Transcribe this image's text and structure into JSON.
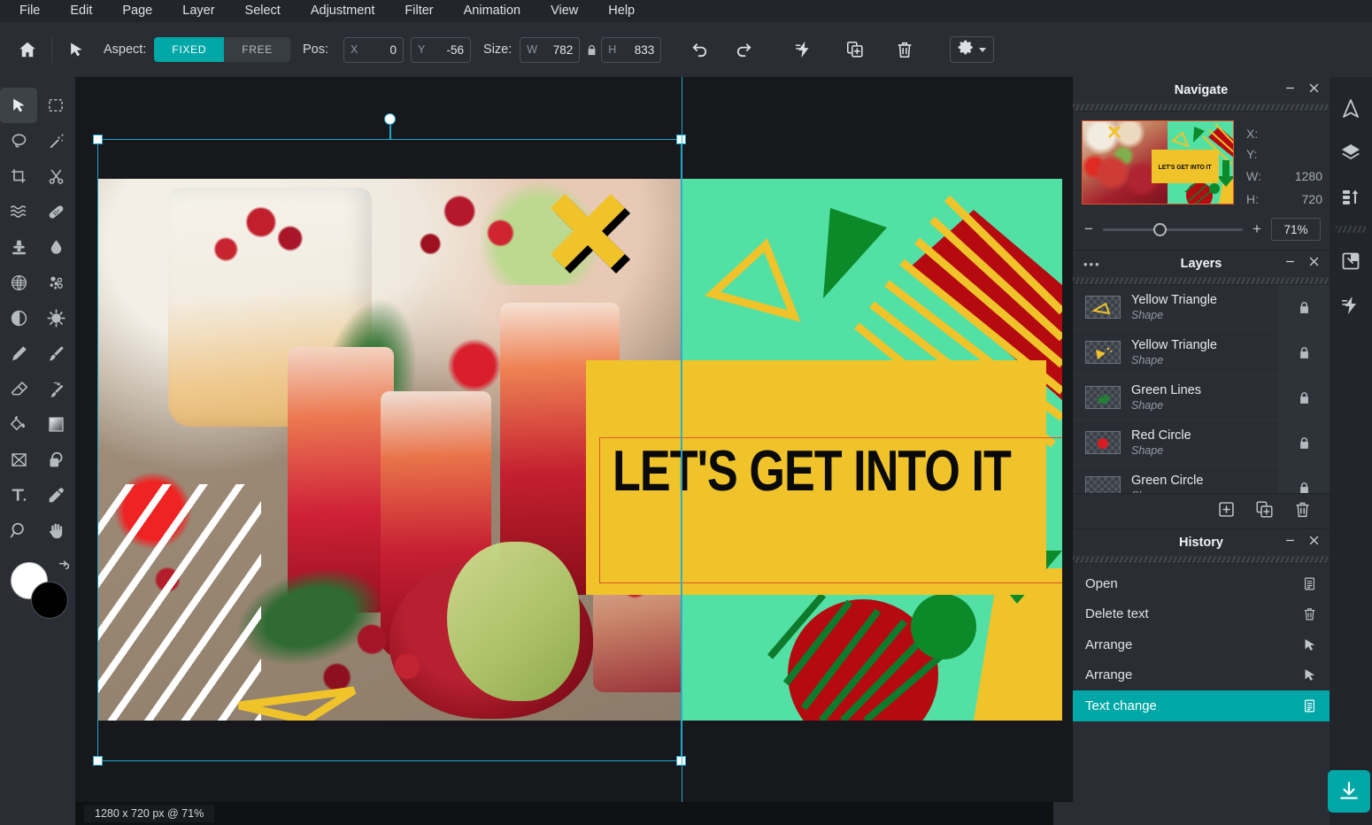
{
  "menu": {
    "items": [
      "File",
      "Edit",
      "Page",
      "Layer",
      "Select",
      "Adjustment",
      "Filter",
      "Animation",
      "View",
      "Help"
    ]
  },
  "toolbar": {
    "home_icon": "home-icon",
    "tool_icon": "cursor-icon",
    "aspect_label": "Aspect:",
    "aspect_fixed": "FIXED",
    "aspect_free": "FREE",
    "pos_label": "Pos:",
    "pos_x_label": "X",
    "pos_x_value": "0",
    "pos_y_label": "Y",
    "pos_y_value": "-56",
    "size_label": "Size:",
    "size_w_label": "W",
    "size_w_value": "782",
    "size_h_label": "H",
    "size_h_value": "833",
    "lock_icon": "lock-icon",
    "undo_icon": "undo-icon",
    "redo_icon": "redo-icon",
    "effects_icon": "lightning-icon",
    "duplicate_icon": "duplicate-icon",
    "delete_icon": "trash-icon",
    "settings_icon": "gear-icon"
  },
  "tools": [
    {
      "name": "move-tool",
      "icon": "cursor-icon",
      "selected": true
    },
    {
      "name": "marquee-select-tool",
      "icon": "marquee-icon",
      "selected": false
    },
    {
      "name": "lasso-tool",
      "icon": "lasso-icon",
      "selected": false
    },
    {
      "name": "magic-wand-tool",
      "icon": "magic-wand-icon",
      "selected": false
    },
    {
      "name": "crop-tool",
      "icon": "crop-icon",
      "selected": false
    },
    {
      "name": "cut-tool",
      "icon": "scissors-icon",
      "selected": false
    },
    {
      "name": "smudge-tool",
      "icon": "wave-icon",
      "selected": false
    },
    {
      "name": "heal-tool",
      "icon": "bandage-icon",
      "selected": false
    },
    {
      "name": "clone-stamp-tool",
      "icon": "stamp-icon",
      "selected": false
    },
    {
      "name": "blur-tool",
      "icon": "droplet-icon",
      "selected": false
    },
    {
      "name": "halftone-tool",
      "icon": "globe-grid-icon",
      "selected": false
    },
    {
      "name": "bokeh-tool",
      "icon": "dots-icon",
      "selected": false
    },
    {
      "name": "contrast-tool",
      "icon": "contrast-icon",
      "selected": false
    },
    {
      "name": "sharpen-tool",
      "icon": "sun-gear-icon",
      "selected": false
    },
    {
      "name": "pen-tool",
      "icon": "pen-icon",
      "selected": false
    },
    {
      "name": "brush-tool",
      "icon": "brush-icon",
      "selected": false
    },
    {
      "name": "eraser-tool",
      "icon": "eraser-icon",
      "selected": false
    },
    {
      "name": "history-brush-tool",
      "icon": "history-brush-icon",
      "selected": false
    },
    {
      "name": "paint-bucket-tool",
      "icon": "paint-bucket-icon",
      "selected": false
    },
    {
      "name": "gradient-tool",
      "icon": "gradient-icon",
      "selected": false
    },
    {
      "name": "transform-tool",
      "icon": "transform-box-icon",
      "selected": false
    },
    {
      "name": "shape-tool",
      "icon": "rounded-shape-icon",
      "selected": false
    },
    {
      "name": "text-tool",
      "icon": "text-t-icon",
      "selected": false
    },
    {
      "name": "eyedropper-tool",
      "icon": "eyedropper-icon",
      "selected": false
    },
    {
      "name": "zoom-tool",
      "icon": "magnifier-icon",
      "selected": false
    },
    {
      "name": "hand-tool",
      "icon": "hand-icon",
      "selected": false
    }
  ],
  "color_swatches": {
    "foreground": "#ffffff",
    "background": "#000000",
    "swap_icon": "swap-arrows-icon"
  },
  "canvas": {
    "banner_text": "LET'S GET INTO IT",
    "status": "1280 x 720 px @ 71%",
    "colors": {
      "mint": "#52e0a4",
      "yellow": "#f0c32b",
      "dark_green": "#0c8a2a",
      "dark_red": "#b50a10",
      "selection": "#1ba7d0",
      "text_box_outline": "#e0552a"
    }
  },
  "navigate": {
    "title": "Navigate",
    "minimize_icon": "minimize-icon",
    "close_icon": "close-icon",
    "x_label": "X:",
    "x_value": "",
    "y_label": "Y:",
    "y_value": "",
    "w_label": "W:",
    "w_value": "1280",
    "h_label": "H:",
    "h_value": "720",
    "zoom_minus": "−",
    "zoom_plus": "+",
    "zoom_value": "71%",
    "thumb_text": "LET'S GET INTO IT"
  },
  "layers": {
    "title": "Layers",
    "options_icon": "more-options-icon",
    "minimize_icon": "minimize-icon",
    "close_icon": "close-icon",
    "items": [
      {
        "name": "Yellow Triangle",
        "type": "Shape",
        "lock_icon": "lock-icon",
        "thumb": "yellow-triangle-outline"
      },
      {
        "name": "Yellow Triangle",
        "type": "Shape",
        "lock_icon": "lock-icon",
        "thumb": "yellow-triangle-filled"
      },
      {
        "name": "Green Lines",
        "type": "Shape",
        "lock_icon": "lock-icon",
        "thumb": "green-lines"
      },
      {
        "name": "Red Circle",
        "type": "Shape",
        "lock_icon": "lock-icon",
        "thumb": "red-circle"
      },
      {
        "name": "Green Circle",
        "type": "Shape",
        "lock_icon": "lock-icon",
        "thumb": "green-circle"
      }
    ],
    "footer": {
      "add_icon": "add-layer-icon",
      "duplicate_icon": "duplicate-layer-icon",
      "delete_icon": "trash-icon"
    }
  },
  "history": {
    "title": "History",
    "minimize_icon": "minimize-icon",
    "close_icon": "close-icon",
    "items": [
      {
        "label": "Open",
        "icon": "document-icon",
        "active": false
      },
      {
        "label": "Delete text",
        "icon": "trash-icon",
        "active": false
      },
      {
        "label": "Arrange",
        "icon": "cursor-icon",
        "active": false
      },
      {
        "label": "Arrange",
        "icon": "cursor-icon",
        "active": false
      },
      {
        "label": "Text change",
        "icon": "document-icon",
        "active": true
      }
    ]
  },
  "edge_rail": {
    "items": [
      {
        "name": "navigate-panel-toggle",
        "icon": "compass-icon"
      },
      {
        "name": "layers-panel-toggle",
        "icon": "layers-icon"
      },
      {
        "name": "history-panel-toggle",
        "icon": "history-icon"
      },
      {
        "name": "canvas-resize-toggle",
        "icon": "resize-icon"
      },
      {
        "name": "effects-panel-toggle",
        "icon": "lightning-icon"
      }
    ]
  },
  "export": {
    "icon": "download-icon",
    "color": "#00a7a7"
  }
}
